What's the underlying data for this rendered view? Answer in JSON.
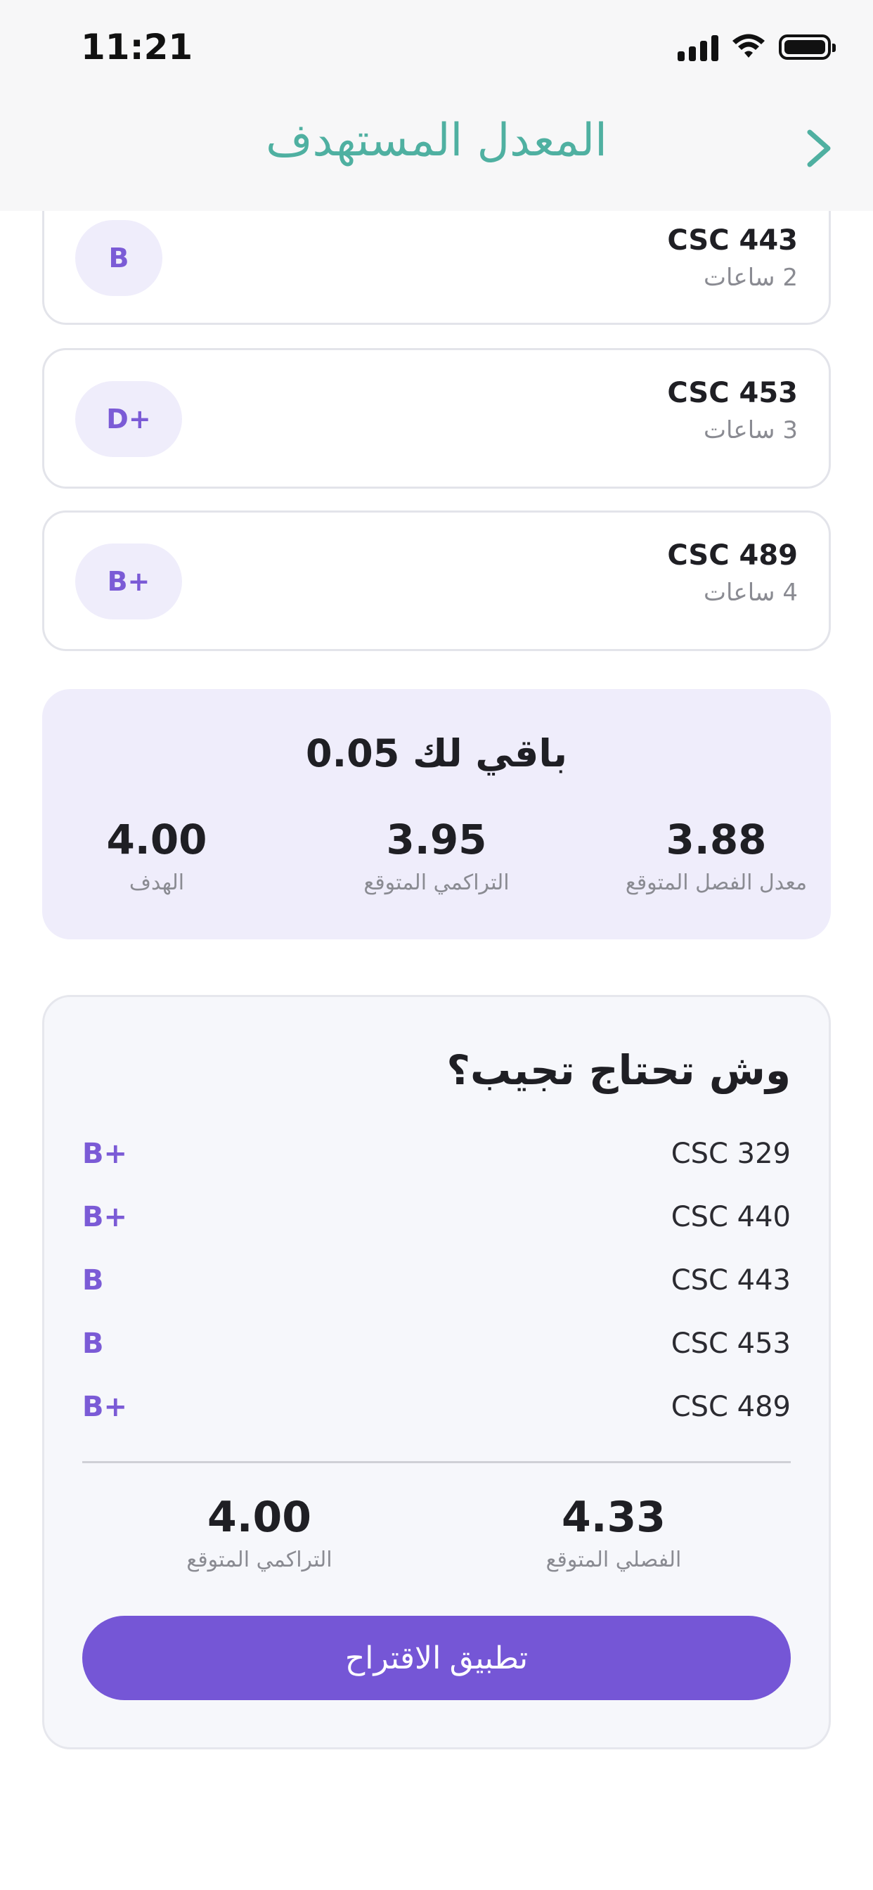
{
  "status_bar": {
    "time": "11:21"
  },
  "header": {
    "title": "المعدل المستهدف"
  },
  "courses": [
    {
      "code": "CSC 443",
      "hours": "2 ساعات",
      "grade": "B"
    },
    {
      "code": "CSC 453",
      "hours": "3 ساعات",
      "grade": "D+"
    },
    {
      "code": "CSC 489",
      "hours": "4 ساعات",
      "grade": "B+"
    }
  ],
  "summary": {
    "title": "باقي لك 0.05",
    "stats": [
      {
        "value": "3.88",
        "label": "معدل الفصل المتوقع"
      },
      {
        "value": "3.95",
        "label": "التراكمي المتوقع"
      },
      {
        "value": "4.00",
        "label": "الهدف"
      }
    ]
  },
  "suggestion": {
    "title": "وش تحتاج تجيب؟",
    "items": [
      {
        "code": "CSC 329",
        "grade": "B+"
      },
      {
        "code": "CSC 440",
        "grade": "B+"
      },
      {
        "code": "CSC 443",
        "grade": "B"
      },
      {
        "code": "CSC 453",
        "grade": "B"
      },
      {
        "code": "CSC 489",
        "grade": "B+"
      }
    ],
    "semester": {
      "value": "4.33",
      "label": "الفصلي المتوقع"
    },
    "cumulative": {
      "value": "4.00",
      "label": "التراكمي المتوقع"
    },
    "apply_label": "تطبيق الاقتراح"
  },
  "colors": {
    "accent": "#7556d6",
    "title": "#4fb0a1",
    "summary_bg": "#efedfb"
  },
  "icons": [
    "cellular-signal-icon",
    "wifi-icon",
    "battery-icon",
    "chevron-right-icon"
  ]
}
